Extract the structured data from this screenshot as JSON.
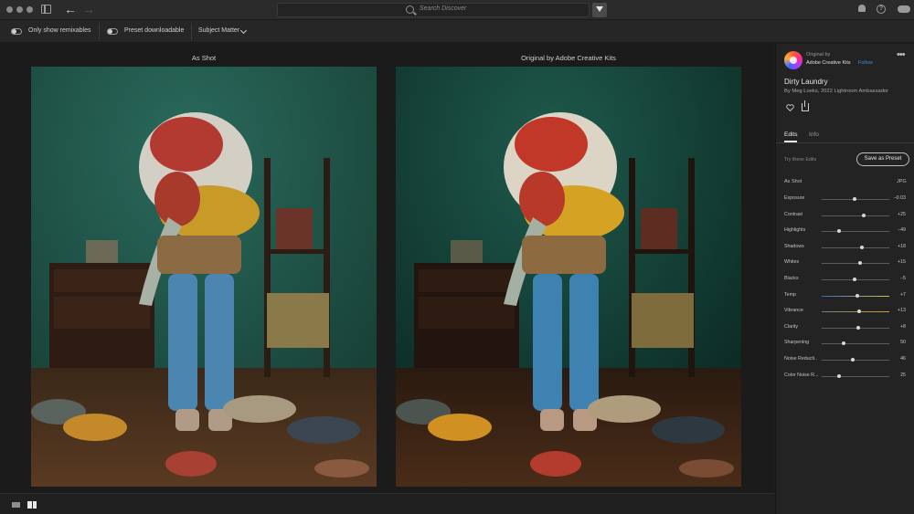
{
  "search": {
    "placeholder": "Search Discover"
  },
  "filters": {
    "remixables": "Only show remixables",
    "preset": "Preset downloadable",
    "subject": "Subject Matter"
  },
  "canvas": {
    "left_label": "As Shot",
    "right_label": "Original by Adobe Creative Kits"
  },
  "panel": {
    "original_by": "Original by",
    "author": "Adobe Creative Kits",
    "follow": "Follow",
    "more": "•••",
    "title": "Dirty Laundry",
    "byline": "By Meg Loeks, 2022 Lightroom Ambassador",
    "tabs": {
      "edits": "Edits",
      "info": "Info"
    },
    "try_edits": "Try these Edits",
    "save_preset": "Save as Preset",
    "as_shot": "As Shot",
    "format": "JPG",
    "sliders": [
      {
        "label": "Exposure",
        "value": "−0.03",
        "level": 0.49
      },
      {
        "label": "Contrast",
        "value": "+25",
        "level": 0.62
      },
      {
        "label": "Highlights",
        "value": "−49",
        "level": 0.25
      },
      {
        "label": "Shadows",
        "value": "+18",
        "level": 0.59
      },
      {
        "label": "Whites",
        "value": "+15",
        "level": 0.57
      },
      {
        "label": "Blacks",
        "value": "−5",
        "level": 0.48
      },
      {
        "label": "Temp",
        "value": "+7",
        "level": 0.53
      },
      {
        "label": "Vibrance",
        "value": "+13",
        "level": 0.55
      },
      {
        "label": "Clarity",
        "value": "+8",
        "level": 0.54
      },
      {
        "label": "Sharpening",
        "value": "50",
        "level": 0.33
      },
      {
        "label": "Noise Reducti..",
        "value": "46",
        "level": 0.46
      },
      {
        "label": "Color Noise R...",
        "value": "25",
        "level": 0.25
      }
    ]
  },
  "colors": {
    "accent": "#3d8fe6",
    "wall_left": "#1c4a40",
    "wall_right": "#0f3a33"
  }
}
